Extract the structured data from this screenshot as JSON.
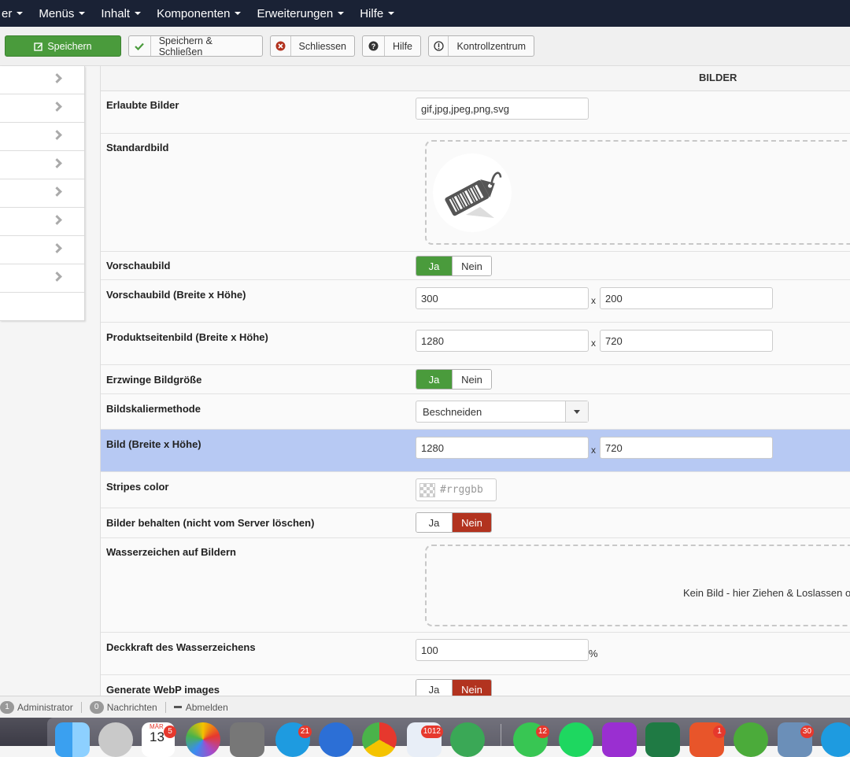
{
  "topnav": {
    "items": [
      {
        "label": "er"
      },
      {
        "label": "Menüs"
      },
      {
        "label": "Inhalt"
      },
      {
        "label": "Komponenten"
      },
      {
        "label": "Erweiterungen"
      },
      {
        "label": "Hilfe"
      }
    ]
  },
  "toolbar": {
    "save": "Speichern",
    "save_close": "Speichern & Schließen",
    "close": "Schliessen",
    "help": "Hilfe",
    "control_center": "Kontrollzentrum"
  },
  "panel": {
    "title": "BILDER"
  },
  "fields": {
    "allowed_images": {
      "label": "Erlaubte Bilder",
      "value": "gif,jpg,jpeg,png,svg"
    },
    "default_image": {
      "label": "Standardbild"
    },
    "thumbnail": {
      "label": "Vorschaubild",
      "yes": "Ja",
      "no": "Nein",
      "selected": "Ja"
    },
    "thumbnail_size": {
      "label": "Vorschaubild (Breite x Höhe)",
      "width": "300",
      "height": "200",
      "sep": "x"
    },
    "product_image_size": {
      "label": "Produktseitenbild (Breite x Höhe)",
      "width": "1280",
      "height": "720",
      "sep": "x"
    },
    "force_size": {
      "label": "Erzwinge Bildgröße",
      "yes": "Ja",
      "no": "Nein",
      "selected": "Ja"
    },
    "scale_method": {
      "label": "Bildskaliermethode",
      "value": "Beschneiden"
    },
    "image_size": {
      "label": "Bild (Breite x Höhe)",
      "width": "1280",
      "height": "720",
      "sep": "x"
    },
    "stripes_color": {
      "label": "Stripes color",
      "placeholder": "#rrggbb"
    },
    "keep_images": {
      "label": "Bilder behalten (nicht vom Server löschen)",
      "yes": "Ja",
      "no": "Nein",
      "selected": "Nein"
    },
    "watermark": {
      "label": "Wasserzeichen auf Bildern",
      "drop_text": "Kein Bild - hier Ziehen & Loslassen o"
    },
    "watermark_opacity": {
      "label": "Deckkraft des Wasserzeichens",
      "value": "100",
      "unit": "%"
    },
    "webp": {
      "label": "Generate WebP images",
      "yes": "Ja",
      "no": "Nein",
      "selected": "Nein"
    }
  },
  "statusbar": {
    "admin_count": "1",
    "admin_label": "Administrator",
    "messages_count": "0",
    "messages_label": "Nachrichten",
    "logout_label": "Abmelden"
  },
  "dock": {
    "calendar_month": "MÄR",
    "calendar_day": "13",
    "calendar_badge": "5",
    "skype_badge": "21",
    "mail_badge": "1012",
    "whatsapp_badge": "12",
    "filezilla_badge": "1",
    "mail2_badge": "30"
  },
  "colors": {
    "accent_green": "#4a9b3c",
    "accent_red": "#b2331f",
    "nav_bg": "#1a2235",
    "highlight_row": "#b7c9f3"
  }
}
